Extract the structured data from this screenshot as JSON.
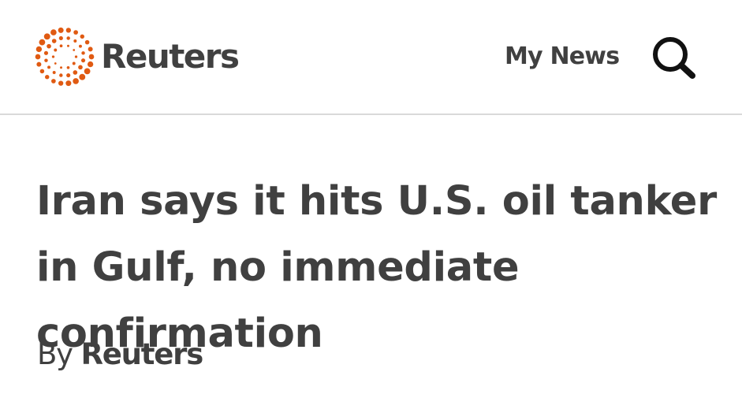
{
  "header": {
    "brand": "Reuters",
    "brand_color": "#fa6400",
    "nav_my_news": "My News",
    "search_icon": "search-icon"
  },
  "article": {
    "headline": "Iran says it hits U.S. oil tanker in Gulf, no immediate confirmation",
    "byline_prefix": "By",
    "byline_author": "Reuters"
  },
  "colors": {
    "text": "#404040",
    "divider": "#d9d9d9",
    "logo_dot": "#e05a12"
  }
}
